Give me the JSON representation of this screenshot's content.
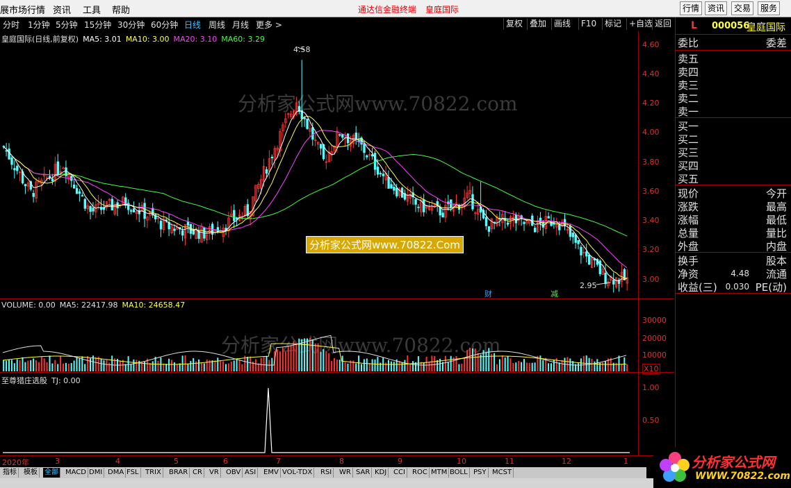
{
  "menubar": {
    "items": [
      "展市场行情",
      "资讯",
      "工具",
      "帮助"
    ],
    "center_title": "通达信金融终端",
    "center_stock": "皇庭国际",
    "right_buttons": [
      "行情",
      "资讯",
      "交易",
      "服务"
    ]
  },
  "periodbar": {
    "periods": [
      "分时",
      "1分钟",
      "5分钟",
      "15分钟",
      "30分钟",
      "60分钟",
      "日线",
      "周线",
      "月线",
      "更多 >"
    ],
    "active": "日线",
    "right_buttons": [
      "复权",
      "叠加",
      "画线",
      "F10",
      "标记",
      "+自选",
      "返回"
    ]
  },
  "kline_legend": {
    "title": "皇庭国际(日线,前复权)",
    "ma5": "MA5: 3.01",
    "ma10": "MA10: 3.00",
    "ma20": "MA20: 3.10",
    "ma60": "MA60: 3.29",
    "colors": {
      "ma5": "#ffffff",
      "ma10": "#ffff40",
      "ma20": "#ff40ff",
      "ma60": "#40ff40"
    }
  },
  "kline_axis": [
    "4.60",
    "4.40",
    "4.20",
    "4.00",
    "3.80",
    "3.60",
    "3.40",
    "3.20",
    "3.00"
  ],
  "annotations": {
    "high": "4.58",
    "low": "2.95",
    "marker1": "财",
    "marker2": "减"
  },
  "watermark": {
    "text": "分析家公式网www.70822.com",
    "box_text": "分析家公式网www.70822.Com"
  },
  "volume_legend": {
    "label": "VOLUME: 0.00",
    "ma5": "MA5: 22417.98",
    "ma10": "MA10: 24658.47"
  },
  "volume_axis": [
    "30000",
    "20000",
    "10000"
  ],
  "volume_unit": "X10",
  "indicator_legend": {
    "label": "至尊猎庄选股",
    "tj": "TJ: 0.00"
  },
  "indicator_axis": [
    "1.00",
    "0.50"
  ],
  "date_axis": [
    "2020年",
    "3",
    "4",
    "5",
    "6",
    "7",
    "8",
    "9",
    "10",
    "11",
    "12",
    "1"
  ],
  "indicator_tabs": [
    "指标",
    "模板",
    "全部",
    "MACD",
    "DMI",
    "DMA",
    "FSL",
    "TRIX",
    "BRAR",
    "CR",
    "VR",
    "OBV",
    "ASI",
    "EMV",
    "VOL-TDX",
    "RSI",
    "WR",
    "SAR",
    "KDJ",
    "CCI",
    "ROC",
    "MTM",
    "BOLL",
    "PSY",
    "MCST"
  ],
  "active_tab": "全部",
  "right_panel": {
    "badge": "L",
    "code": "000056",
    "name": "皇庭国际",
    "weibi": "委比",
    "weicha": "委差",
    "sells": [
      "卖五",
      "卖四",
      "卖三",
      "卖二",
      "卖一"
    ],
    "buys": [
      "买一",
      "买二",
      "买三",
      "买四",
      "买五"
    ],
    "stats_left": [
      "现价",
      "涨跌",
      "涨幅",
      "总量",
      "外盘"
    ],
    "stats_right": [
      "今开",
      "最高",
      "最低",
      "量比",
      "内盘"
    ],
    "fin_left": [
      "换手",
      "净资",
      "收益(三)"
    ],
    "fin_values": [
      "",
      "4.48",
      "0.030"
    ],
    "fin_right": [
      "股本",
      "流通",
      "PE(动)"
    ]
  },
  "logo": {
    "line1": "分析家公式网",
    "line2": "WWW.70822.com"
  }
}
